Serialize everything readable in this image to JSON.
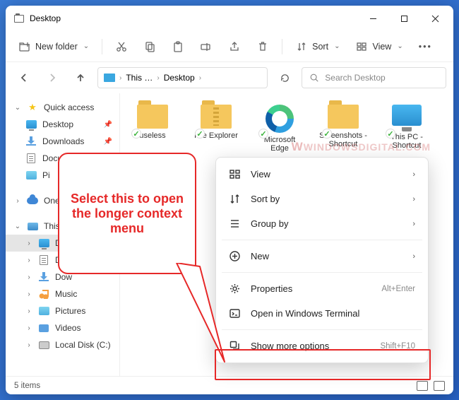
{
  "title": "Desktop",
  "toolbar": {
    "new_folder": "New folder",
    "sort": "Sort",
    "view": "View"
  },
  "address": {
    "crumb1": "This …",
    "crumb2": "Desktop"
  },
  "search_placeholder": "Search Desktop",
  "sidebar": {
    "quick_access": "Quick access",
    "desktop": "Desktop",
    "downloads": "Downloads",
    "documents": "Documents",
    "pictures_short": "Pi",
    "onedrive_short": "One",
    "this_pc_short": "This",
    "desktop_short": "De",
    "documents_short": "Do",
    "downloads_short": "Dow",
    "music": "Music",
    "pictures": "Pictures",
    "videos": "Videos",
    "local_disk": "Local Disk (C:)"
  },
  "items": {
    "useless": "useless",
    "file_explorer": "File Explorer",
    "edge": "Microsoft Edge",
    "screenshots": "Screenshots - Shortcut",
    "this_pc": "This PC - Shortcut"
  },
  "context_menu": {
    "view": "View",
    "sort_by": "Sort by",
    "group_by": "Group by",
    "new": "New",
    "properties": "Properties",
    "properties_shortcut": "Alt+Enter",
    "terminal": "Open in Windows Terminal",
    "show_more": "Show more options",
    "show_more_shortcut": "Shift+F10"
  },
  "callout_text": "Select this to open the longer context menu",
  "watermark": "WINDOWSDIGITAL.COM",
  "status": {
    "count": "5 items"
  }
}
